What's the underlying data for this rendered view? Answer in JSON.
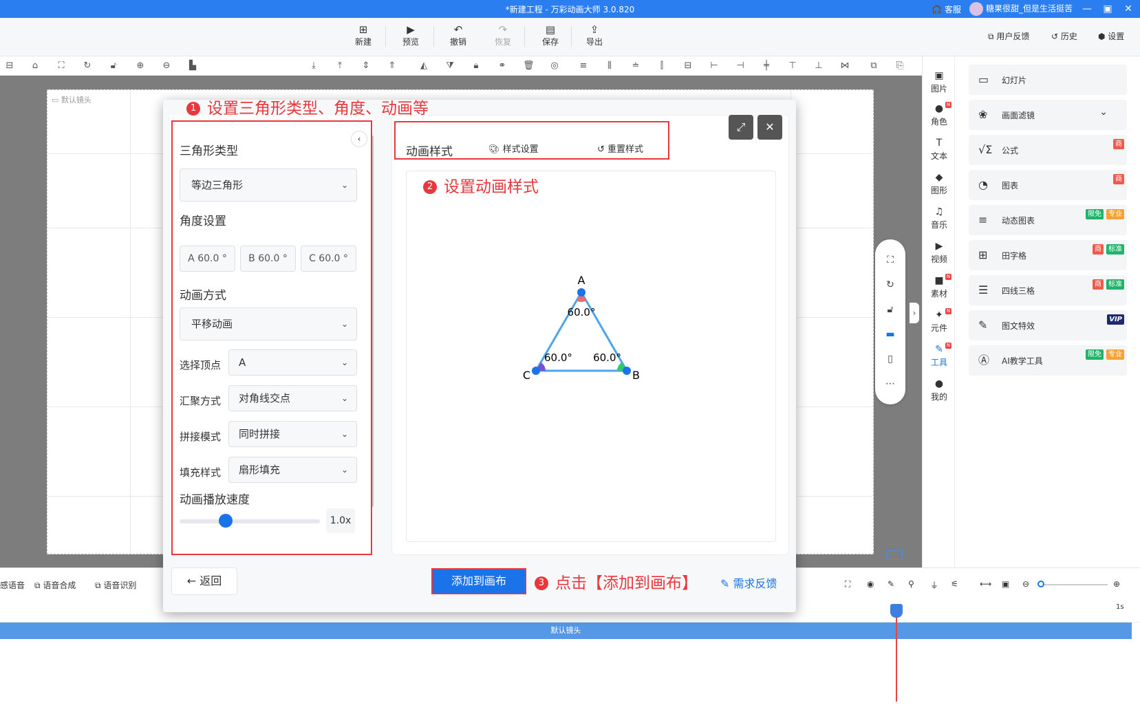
{
  "titlebar": {
    "title": "*新建工程 - 万彩动画大师 3.0.820",
    "service": "客服",
    "user": "糖果很甜_但是生活挺苦",
    "min": "—",
    "restore": "▣",
    "close": "✕"
  },
  "toolbar": {
    "new": "新建",
    "preview": "预览",
    "undo": "撤销",
    "redo": "恢复",
    "save": "保存",
    "export": "导出",
    "feedback": "用户反馈",
    "history": "历史",
    "settings": "设置"
  },
  "canvas": {
    "label": "默认镜头"
  },
  "right_icons": [
    {
      "label": "图片",
      "icon": "▣",
      "dot": false
    },
    {
      "label": "角色",
      "icon": "●",
      "dot": true
    },
    {
      "label": "文本",
      "icon": "T",
      "dot": false
    },
    {
      "label": "图形",
      "icon": "◆",
      "dot": false
    },
    {
      "label": "音乐",
      "icon": "♫",
      "dot": false
    },
    {
      "label": "视频",
      "icon": "▶",
      "dot": false
    },
    {
      "label": "素材",
      "icon": "■",
      "dot": true
    },
    {
      "label": "元件",
      "icon": "✦",
      "dot": true
    },
    {
      "label": "工具",
      "icon": "✎",
      "dot": true
    },
    {
      "label": "我的",
      "icon": "●",
      "dot": false
    }
  ],
  "right_panel": {
    "items": [
      {
        "label": "幻灯片",
        "icon": "▭",
        "badges": []
      },
      {
        "label": "画面滤镜",
        "icon": "❀",
        "badges": [],
        "chevron": "⌄"
      },
      {
        "label": "公式",
        "icon": "√Σ",
        "badges": [
          {
            "text": "商",
            "color": "red"
          }
        ]
      },
      {
        "label": "图表",
        "icon": "◔",
        "badges": [
          {
            "text": "商",
            "color": "red"
          }
        ]
      },
      {
        "label": "动态图表",
        "icon": "≡",
        "badges": [
          {
            "text": "限免",
            "color": "green"
          },
          {
            "text": "专业",
            "color": "orange"
          }
        ]
      },
      {
        "label": "田字格",
        "icon": "⊞",
        "badges": [
          {
            "text": "商",
            "color": "red"
          },
          {
            "text": "标准",
            "color": "green"
          }
        ]
      },
      {
        "label": "四线三格",
        "icon": "☰",
        "badges": [
          {
            "text": "商",
            "color": "red"
          },
          {
            "text": "标准",
            "color": "green"
          }
        ]
      },
      {
        "label": "图文特效",
        "icon": "✎",
        "badges": [
          {
            "text": "VIP",
            "color": "vip"
          }
        ]
      },
      {
        "label": "AI教学工具",
        "icon": "Ⓐ",
        "badges": [
          {
            "text": "限免",
            "color": "green"
          },
          {
            "text": "专业",
            "color": "orange"
          }
        ]
      }
    ]
  },
  "timeline": {
    "items": [
      "感语音",
      "语音合成",
      "语音识别"
    ],
    "track_label": "默认镜头",
    "time_label": "1s"
  },
  "dialog": {
    "triangle_type_label": "三角形类型",
    "triangle_type_value": "等边三角形",
    "angle_label": "角度设置",
    "angles": [
      "A 60.0 °",
      "B 60.0 °",
      "C 60.0 °"
    ],
    "anim_method_label": "动画方式",
    "anim_method_value": "平移动画",
    "rows": [
      {
        "label": "选择顶点",
        "value": "A"
      },
      {
        "label": "汇聚方式",
        "value": "对角线交点"
      },
      {
        "label": "拼接模式",
        "value": "同时拼接"
      },
      {
        "label": "填充样式",
        "value": "扇形填充"
      }
    ],
    "speed_label": "动画播放速度",
    "speed_value": "1.0x",
    "speed_fraction": 0.33,
    "style_title": "动画样式",
    "style_settings": "样式设置",
    "reset_style": "重置样式",
    "back": "返回",
    "add_to_canvas": "添加到画布",
    "demand_feedback": "需求反馈",
    "triangle": {
      "vertex_a": "A",
      "vertex_b": "B",
      "vertex_c": "C",
      "angle_a": "60.0°",
      "angle_b": "60.0°",
      "angle_c": "60.0°",
      "colors": {
        "edge": "#4da3ec",
        "vertex": "#1a73e8",
        "a": "#f06b6b",
        "b": "#2ecc71",
        "c": "#7b4fd6"
      }
    }
  },
  "annotations": {
    "a1": {
      "num": "1",
      "text": "设置三角形类型、角度、动画等"
    },
    "a2": {
      "num": "2",
      "text": "设置动画样式"
    },
    "a3": {
      "num": "3",
      "text": "点击【添加到画布】"
    }
  }
}
